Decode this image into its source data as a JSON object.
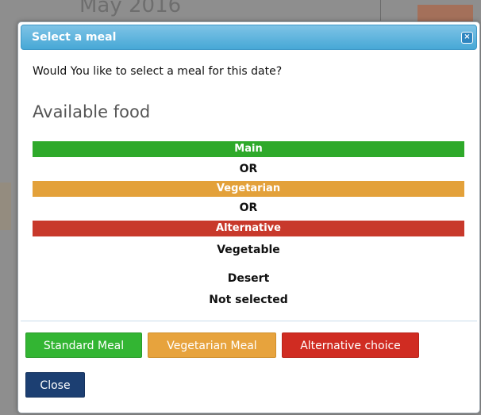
{
  "background": {
    "heading": "May 2016"
  },
  "dialog": {
    "title": "Select a meal",
    "close_icon": "×",
    "prompt": "Would You like to select a meal for this date?",
    "available_heading": "Available food",
    "options": {
      "main": "Main",
      "or_1": "OR",
      "vegetarian": "Vegetarian",
      "or_2": "OR",
      "alternative": "Alternative",
      "vegetable": "Vegetable",
      "desert": "Desert",
      "desert_status": "Not selected"
    },
    "buttons": {
      "standard": "Standard Meal",
      "vegetarian": "Vegetarian Meal",
      "alternative": "Alternative choice",
      "close": "Close"
    }
  },
  "colors": {
    "title_bar": "#47a8d6",
    "main": "#2ea92a",
    "vegetarian": "#e3a13a",
    "alternative": "#c8392b",
    "close_button": "#1c3f72"
  }
}
